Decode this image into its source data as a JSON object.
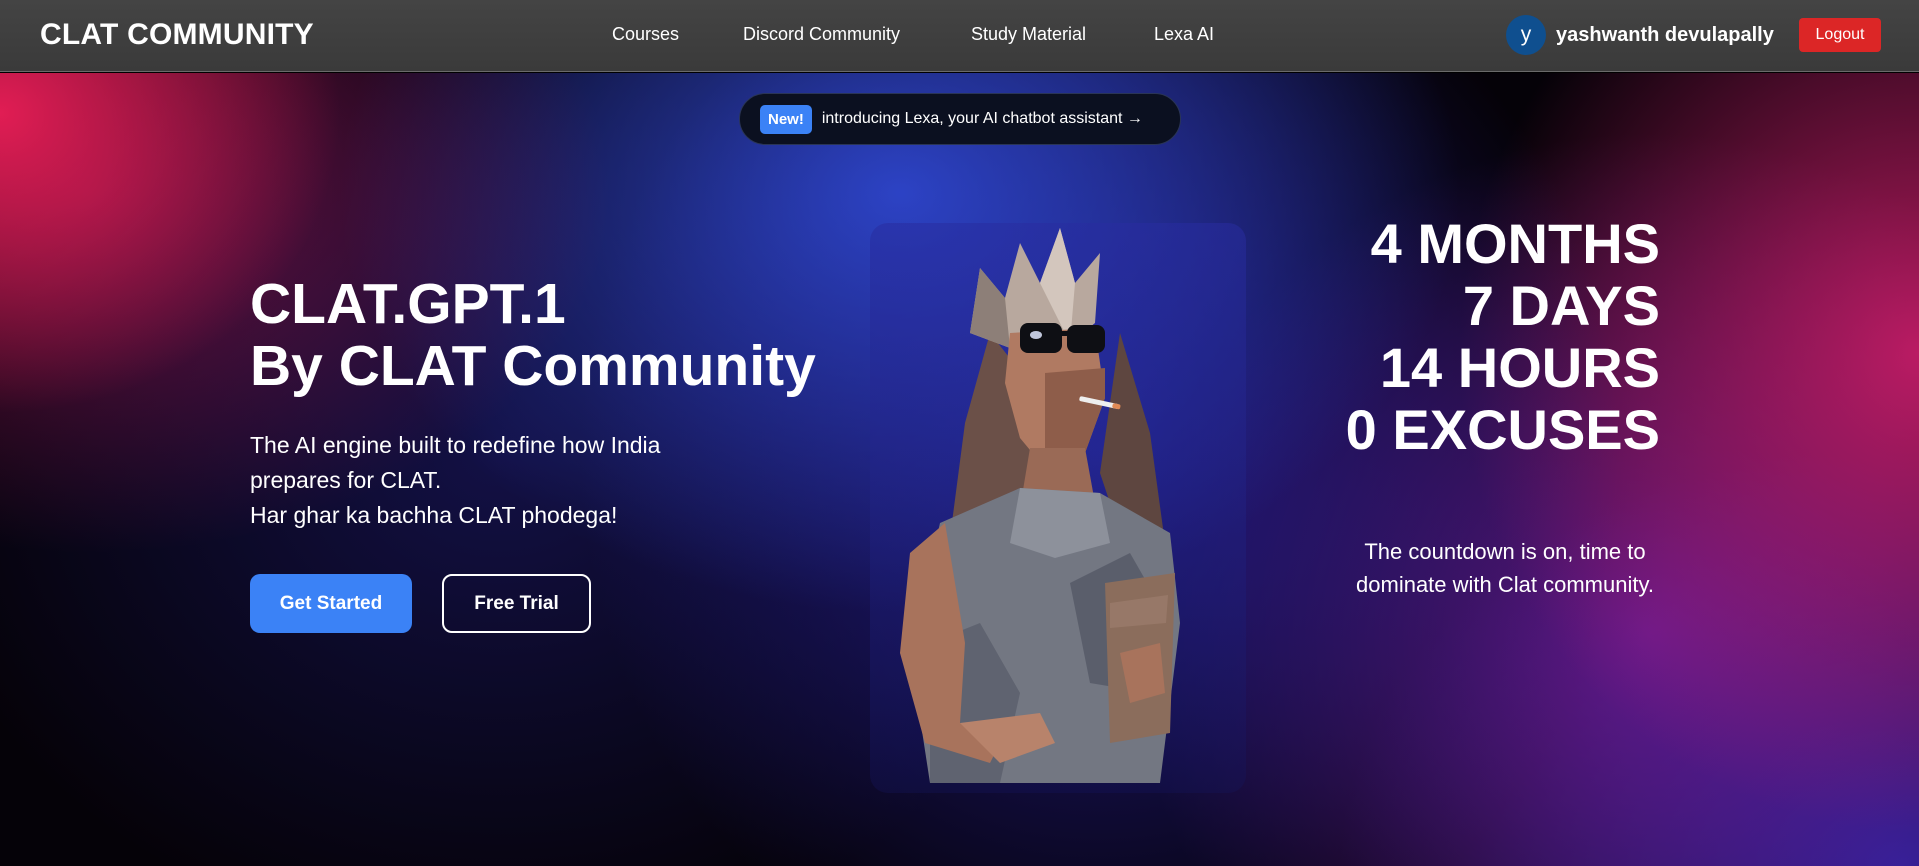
{
  "navbar": {
    "brand": "CLAT COMMUNITY",
    "links": [
      {
        "label": "Courses"
      },
      {
        "label": "Discord Community"
      },
      {
        "label": "Study Material"
      },
      {
        "label": "Lexa AI"
      }
    ],
    "user": {
      "avatar_initial": "y",
      "name": "yashwanth devulapally"
    },
    "logout_label": "Logout"
  },
  "announcement": {
    "badge": "New!",
    "text": "introducing Lexa, your AI chatbot assistant →"
  },
  "hero": {
    "title_line1": "CLAT.GPT.1",
    "title_line2": "By CLAT Community",
    "subtitle_line1": "The AI engine built to redefine how India",
    "subtitle_line2": "prepares for CLAT.",
    "subtitle_line3": "Har ghar ka bachha CLAT phodega!",
    "primary_button": "Get Started",
    "secondary_button": "Free Trial"
  },
  "countdown": {
    "lines": [
      "4 MONTHS",
      "7 DAYS",
      "14 HOURS",
      "0 EXCUSES"
    ],
    "tagline_line1": "The countdown is on, time to",
    "tagline_line2": "dominate with Clat community."
  },
  "colors": {
    "primary": "#3b82f6",
    "logout": "#dc2626",
    "navbar": "#3f3f3f"
  }
}
